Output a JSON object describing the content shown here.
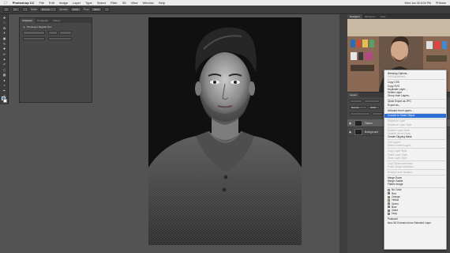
{
  "menubar": {
    "app_name": "Photoshop CC",
    "items": [
      "File",
      "Edit",
      "Image",
      "Layer",
      "Type",
      "Select",
      "Filter",
      "3D",
      "View",
      "Window",
      "Help"
    ],
    "clock": "Wed Jun 26 8:04 PM",
    "user": "PHlearn"
  },
  "options_bar": {
    "mode_label": "Mode:",
    "mode_value": "Normal",
    "opacity_label": "Opacity:",
    "opacity_value": "100%",
    "flow_label": "Flow:",
    "flow_value": "100%"
  },
  "float_panel": {
    "tabs": [
      "Character",
      "Paragraph",
      "History"
    ],
    "font_name": "PixelLayer Regular Dev"
  },
  "right_panel": {
    "tabs": [
      "Navigator",
      "Histogram",
      "Color"
    ]
  },
  "layers_panel": {
    "tab": "Layers",
    "blend_value": "Normal",
    "opacity_value": "100%",
    "layers": [
      {
        "name": "Flatten",
        "selected": true
      },
      {
        "name": "Background",
        "selected": false
      }
    ]
  },
  "context_menu": {
    "items": [
      {
        "label": "Blending Options...",
        "enabled": true
      },
      {
        "label": "Edit Adjustment...",
        "enabled": false
      },
      {
        "sep": true
      },
      {
        "label": "Copy CSS",
        "enabled": true
      },
      {
        "label": "Copy SVG",
        "enabled": true
      },
      {
        "label": "Duplicate Layer...",
        "enabled": true
      },
      {
        "label": "Delete Layer",
        "enabled": true
      },
      {
        "label": "Group from Layers...",
        "enabled": true
      },
      {
        "sep": true
      },
      {
        "label": "Quick Export as JPG",
        "enabled": true
      },
      {
        "label": "Export As...",
        "enabled": true
      },
      {
        "sep": true
      },
      {
        "label": "Artboard from Layers...",
        "enabled": true
      },
      {
        "sep": true
      },
      {
        "label": "Convert to Smart Object",
        "enabled": true,
        "highlighted": true
      },
      {
        "sep": true
      },
      {
        "label": "Rasterize Layer",
        "enabled": false
      },
      {
        "label": "Rasterize Layer Style",
        "enabled": false
      },
      {
        "sep": true
      },
      {
        "label": "Disable Layer Mask",
        "enabled": false
      },
      {
        "label": "Disable Vector Mask",
        "enabled": false
      },
      {
        "label": "Create Clipping Mask",
        "enabled": true
      },
      {
        "sep": true
      },
      {
        "label": "Link Layers",
        "enabled": false
      },
      {
        "label": "Select Linked Layers",
        "enabled": false
      },
      {
        "sep": true
      },
      {
        "label": "Copy Layer Style",
        "enabled": false
      },
      {
        "label": "Paste Layer Style",
        "enabled": false
      },
      {
        "label": "Clear Layer Style",
        "enabled": false
      },
      {
        "sep": true
      },
      {
        "label": "Copy Shape Attributes",
        "enabled": false
      },
      {
        "label": "Paste Shape Attributes",
        "enabled": false
      },
      {
        "sep": true
      },
      {
        "label": "Release from Isolation",
        "enabled": false
      },
      {
        "sep": true
      },
      {
        "label": "Merge Down",
        "enabled": true
      },
      {
        "label": "Merge Visible",
        "enabled": true
      },
      {
        "label": "Flatten Image",
        "enabled": true
      },
      {
        "sep": true
      },
      {
        "label": "No Color",
        "enabled": true,
        "color": "#ffffff"
      },
      {
        "label": "Red",
        "enabled": true,
        "color": "#e05252"
      },
      {
        "label": "Orange",
        "enabled": true,
        "color": "#f0a040"
      },
      {
        "label": "Yellow",
        "enabled": true,
        "color": "#f0e050"
      },
      {
        "label": "Green",
        "enabled": true,
        "color": "#6cc36c"
      },
      {
        "label": "Blue",
        "enabled": true,
        "color": "#6a9ee0"
      },
      {
        "label": "Violet",
        "enabled": true,
        "color": "#a98adf"
      },
      {
        "label": "Gray",
        "enabled": true,
        "color": "#b5b5b5"
      },
      {
        "sep": true
      },
      {
        "label": "Postcard",
        "enabled": true
      },
      {
        "label": "New 3D Extrusion from Selected Layer",
        "enabled": true
      }
    ]
  },
  "colors": {
    "menu_highlight": "#2d6fd6",
    "foreground_swatch": "#2f7fc4",
    "background_swatch": "#ffffff"
  }
}
